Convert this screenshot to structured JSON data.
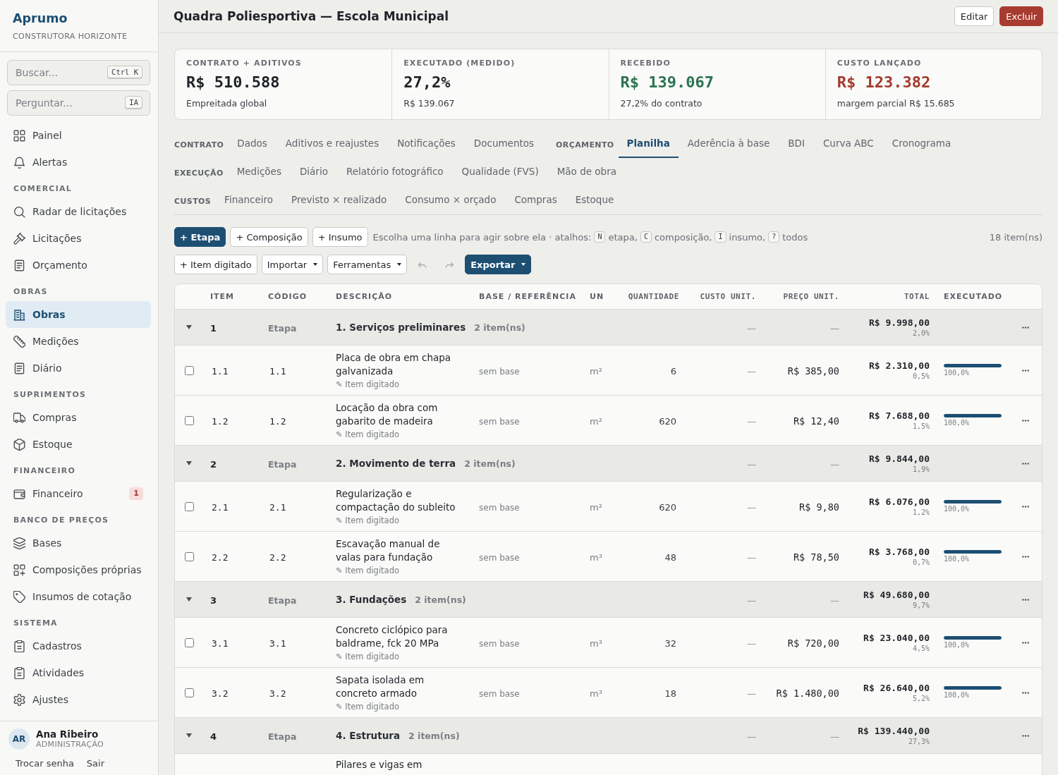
{
  "sidebar": {
    "brand": {
      "name": "Aprumo",
      "company": "CONSTRUTORA HORIZONTE"
    },
    "search": {
      "placeholder": "Buscar...",
      "shortcut": "Ctrl K"
    },
    "ask": {
      "placeholder": "Perguntar...",
      "shortcut": "IA"
    },
    "nav": [
      {
        "items": [
          {
            "label": "Painel",
            "selected": false
          },
          {
            "label": "Alertas",
            "selected": false
          }
        ]
      },
      {
        "title": "COMERCIAL",
        "items": [
          {
            "label": "Radar de licitações",
            "selected": false
          },
          {
            "label": "Licitações",
            "selected": false
          },
          {
            "label": "Orçamento",
            "selected": false
          }
        ]
      },
      {
        "title": "OBRAS",
        "items": [
          {
            "label": "Obras",
            "selected": true
          },
          {
            "label": "Medições",
            "selected": false
          },
          {
            "label": "Diário",
            "selected": false
          }
        ]
      },
      {
        "title": "SUPRIMENTOS",
        "items": [
          {
            "label": "Compras",
            "selected": false
          },
          {
            "label": "Estoque",
            "selected": false
          }
        ]
      },
      {
        "title": "FINANCEIRO",
        "items": [
          {
            "label": "Financeiro",
            "selected": false,
            "badge": "1"
          }
        ]
      },
      {
        "title": "BANCO DE PREÇOS",
        "items": [
          {
            "label": "Bases",
            "selected": false
          },
          {
            "label": "Composições próprias",
            "selected": false
          },
          {
            "label": "Insumos de cotação",
            "selected": false
          }
        ]
      },
      {
        "title": "SISTEMA",
        "items": [
          {
            "label": "Cadastros",
            "selected": false
          },
          {
            "label": "Atividades",
            "selected": false
          },
          {
            "label": "Ajustes",
            "selected": false
          }
        ]
      }
    ],
    "user": {
      "initials": "AR",
      "name": "Ana Ribeiro",
      "role": "ADMINISTRAÇÃO"
    },
    "links": [
      "Trocar senha",
      "Sair"
    ]
  },
  "header": {
    "title": "Quadra Poliesportiva — Escola Municipal",
    "actions": [
      {
        "label": "Editar",
        "kind": "secondary"
      },
      {
        "label": "Excluir",
        "kind": "danger"
      }
    ]
  },
  "summary": [
    {
      "label": "CONTRATO + ADITIVOS",
      "value": "R$ 510.588",
      "note": "Empreitada global",
      "color": "#1f2328"
    },
    {
      "label": "EXECUTADO (MEDIDO)",
      "value": "27,2%",
      "note": "R$ 139.067",
      "color": "#1f2328"
    },
    {
      "label": "RECEBIDO",
      "value": "R$ 139.067",
      "note": "27,2% do contrato",
      "color": "#2b7350"
    },
    {
      "label": "CUSTO LANÇADO",
      "value": "R$ 123.382",
      "note": "margem parcial R$ 15.685",
      "color": "#a33b2e"
    }
  ],
  "tab_rows": [
    {
      "groups": [
        {
          "label": "CONTRATO",
          "tabs": [
            {
              "label": "Dados",
              "selected": false
            },
            {
              "label": "Aditivos e reajustes",
              "selected": false
            },
            {
              "label": "Notificações",
              "selected": false
            },
            {
              "label": "Documentos",
              "selected": false
            }
          ]
        },
        {
          "label": "ORÇAMENTO",
          "tabs": [
            {
              "label": "Planilha",
              "selected": true
            },
            {
              "label": "Aderência à base",
              "selected": false
            },
            {
              "label": "BDI",
              "selected": false
            },
            {
              "label": "Curva ABC",
              "selected": false
            },
            {
              "label": "Cronograma",
              "selected": false
            }
          ]
        }
      ]
    },
    {
      "groups": [
        {
          "label": "EXECUÇÃO",
          "tabs": [
            {
              "label": "Medições",
              "selected": false
            },
            {
              "label": "Diário",
              "selected": false
            },
            {
              "label": "Relatório fotográfico",
              "selected": false
            },
            {
              "label": "Qualidade (FVS)",
              "selected": false
            },
            {
              "label": "Mão de obra",
              "selected": false
            }
          ]
        }
      ]
    },
    {
      "groups": [
        {
          "label": "CUSTOS",
          "tabs": [
            {
              "label": "Financeiro",
              "selected": false
            },
            {
              "label": "Previsto × realizado",
              "selected": false
            },
            {
              "label": "Consumo × orçado",
              "selected": false
            },
            {
              "label": "Compras",
              "selected": false
            },
            {
              "label": "Estoque",
              "selected": false
            }
          ]
        }
      ]
    }
  ],
  "toolbar": {
    "primary_actions": [
      {
        "kind": "primary",
        "label": "+ Etapa",
        "dropdown": false,
        "disabled": false
      },
      {
        "kind": "button",
        "label": "+ Composição",
        "dropdown": false,
        "disabled": false
      },
      {
        "kind": "button",
        "label": "+ Insumo",
        "dropdown": false,
        "disabled": false
      }
    ],
    "hint": {
      "text": "Escolha uma linha para agir sobre ela · atalhos:",
      "shortcuts": [
        {
          "key": "N",
          "label": "etapa,"
        },
        {
          "key": "C",
          "label": "composição,"
        },
        {
          "key": "I",
          "label": "insumo,"
        },
        {
          "key": "?",
          "label": "todos"
        }
      ]
    },
    "count": "18 item(ns)",
    "secondary_actions": [
      {
        "kind": "button",
        "label": "+ Item digitado",
        "dropdown": false,
        "disabled": false
      },
      {
        "kind": "button",
        "label": "Importar",
        "dropdown": true,
        "disabled": false
      },
      {
        "kind": "button",
        "label": "Ferramentas",
        "dropdown": true,
        "disabled": false
      },
      {
        "kind": "undo",
        "disabled": true
      },
      {
        "kind": "redo",
        "disabled": true
      },
      {
        "kind": "primary",
        "label": "Exportar",
        "dropdown": true,
        "disabled": false
      }
    ]
  },
  "table": {
    "columns": [
      "ITEM",
      "CÓDIGO",
      "DESCRIÇÃO",
      "BASE / REFERÊNCIA",
      "UN",
      "QUANTIDADE",
      "CUSTO UNIT.",
      "PREÇO UNIT.",
      "TOTAL",
      "EXECUTADO"
    ],
    "rows": [
      {
        "kind": "stage",
        "expanded": true,
        "item": "1",
        "code": "Etapa",
        "description": "1. Serviços preliminares",
        "count": "2 item(ns)",
        "unit_cost": "—",
        "unit_price": "—",
        "total": "R$ 9.998,00",
        "share": "2,0%"
      },
      {
        "kind": "item",
        "checked": false,
        "item": "1.1",
        "code": "1.1",
        "description": "Placa de obra em chapa galvanizada",
        "note": "✎ Item digitado",
        "base": "sem base",
        "unit": "m²",
        "quantity": "6",
        "unit_cost": "—",
        "unit_price": "R$ 385,00",
        "total": "R$ 2.310,00",
        "share": "0,5%",
        "level": 1,
        "executed": "100,0%"
      },
      {
        "kind": "item",
        "checked": false,
        "item": "1.2",
        "code": "1.2",
        "description": "Locação da obra com gabarito de madeira",
        "note": "✎ Item digitado",
        "base": "sem base",
        "unit": "m²",
        "quantity": "620",
        "unit_cost": "—",
        "unit_price": "R$ 12,40",
        "total": "R$ 7.688,00",
        "share": "1,5%",
        "level": 1,
        "executed": "100,0%"
      },
      {
        "kind": "stage",
        "expanded": true,
        "item": "2",
        "code": "Etapa",
        "description": "2. Movimento de terra",
        "count": "2 item(ns)",
        "unit_cost": "—",
        "unit_price": "—",
        "total": "R$ 9.844,00",
        "share": "1,9%"
      },
      {
        "kind": "item",
        "checked": false,
        "item": "2.1",
        "code": "2.1",
        "description": "Regularização e compactação do subleito",
        "note": "✎ Item digitado",
        "base": "sem base",
        "unit": "m²",
        "quantity": "620",
        "unit_cost": "—",
        "unit_price": "R$ 9,80",
        "total": "R$ 6.076,00",
        "share": "1,2%",
        "level": 1,
        "executed": "100,0%"
      },
      {
        "kind": "item",
        "checked": false,
        "item": "2.2",
        "code": "2.2",
        "description": "Escavação manual de valas para fundação",
        "note": "✎ Item digitado",
        "base": "sem base",
        "unit": "m³",
        "quantity": "48",
        "unit_cost": "—",
        "unit_price": "R$ 78,50",
        "total": "R$ 3.768,00",
        "share": "0,7%",
        "level": 1,
        "executed": "100,0%"
      },
      {
        "kind": "stage",
        "expanded": true,
        "item": "3",
        "code": "Etapa",
        "description": "3. Fundações",
        "count": "2 item(ns)",
        "unit_cost": "—",
        "unit_price": "—",
        "total": "R$ 49.680,00",
        "share": "9,7%"
      },
      {
        "kind": "item",
        "checked": false,
        "item": "3.1",
        "code": "3.1",
        "description": "Concreto ciclópico para baldrame, fck 20 MPa",
        "note": "✎ Item digitado",
        "base": "sem base",
        "unit": "m³",
        "quantity": "32",
        "unit_cost": "—",
        "unit_price": "R$ 720,00",
        "total": "R$ 23.040,00",
        "share": "4,5%",
        "level": 1,
        "executed": "100,0%"
      },
      {
        "kind": "item",
        "checked": false,
        "item": "3.2",
        "code": "3.2",
        "description": "Sapata isolada em concreto armado",
        "note": "✎ Item digitado",
        "base": "sem base",
        "unit": "m³",
        "quantity": "18",
        "unit_cost": "—",
        "unit_price": "R$ 1.480,00",
        "total": "R$ 26.640,00",
        "share": "5,2%",
        "level": 1,
        "executed": "100,0%"
      },
      {
        "kind": "stage",
        "expanded": true,
        "item": "4",
        "code": "Etapa",
        "description": "4. Estrutura",
        "count": "2 item(ns)",
        "unit_cost": "—",
        "unit_price": "—",
        "total": "R$ 139.440,00",
        "share": "27,3%"
      },
      {
        "kind": "partial",
        "description": "Pilares e vigas em"
      }
    ]
  }
}
